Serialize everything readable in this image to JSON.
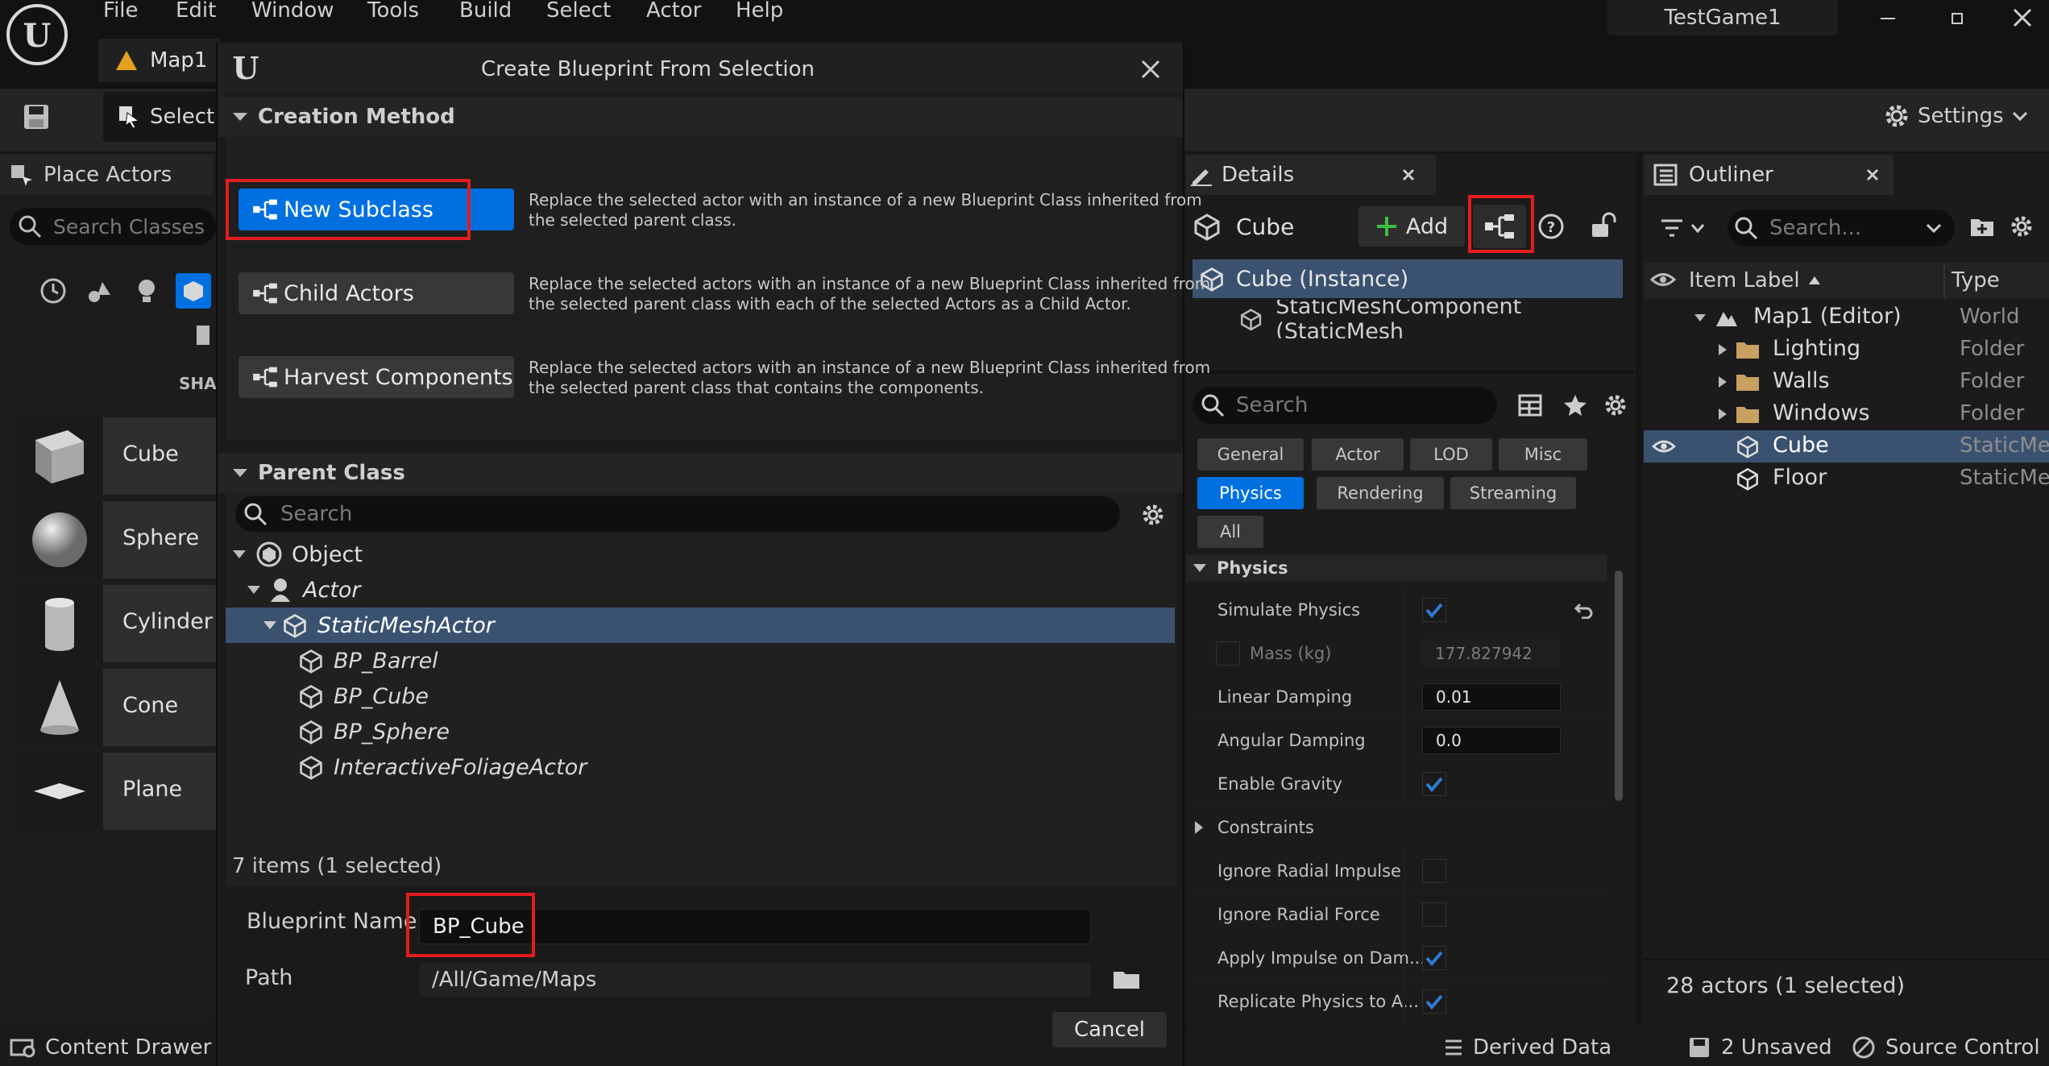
{
  "menu": [
    "File",
    "Edit",
    "Window",
    "Tools",
    "Build",
    "Select",
    "Actor",
    "Help"
  ],
  "project_name": "TestGame1",
  "map_tab": "Map1",
  "toolbar": {
    "select_label": "Select",
    "settings_label": "Settings"
  },
  "place_actors": {
    "title": "Place Actors",
    "search_placeholder": "Search Classes",
    "section_label": "SHA",
    "items": [
      "Cube",
      "Sphere",
      "Cylinder",
      "Cone",
      "Plane"
    ]
  },
  "content_drawer": "Content Drawer",
  "dialog": {
    "title": "Create Blueprint From Selection",
    "creation_method_header": "Creation Method",
    "methods": [
      {
        "label": "New Subclass",
        "desc1": "Replace the selected actor with an instance of a new Blueprint Class inherited from",
        "desc2": "the selected parent class."
      },
      {
        "label": "Child Actors",
        "desc1": "Replace the selected actors with an instance of a new Blueprint Class inherited from",
        "desc2": "the selected parent class with each of the selected Actors as a Child Actor."
      },
      {
        "label": "Harvest Components",
        "desc1": "Replace the selected actors with an instance of a new Blueprint Class inherited from",
        "desc2": "the selected parent class that contains the components."
      }
    ],
    "parent_class_header": "Parent Class",
    "search_placeholder": "Search",
    "tree": [
      "Object",
      "Actor",
      "StaticMeshActor",
      "BP_Barrel",
      "BP_Cube",
      "BP_Sphere",
      "InteractiveFoliageActor"
    ],
    "items_count": "7 items (1 selected)",
    "blueprint_name_label": "Blueprint Name",
    "blueprint_name_value": "BP_Cube",
    "path_label": "Path",
    "path_value": "/All/Game/Maps",
    "cancel_label": "Cancel"
  },
  "details": {
    "title": "Details",
    "actor_name": "Cube",
    "add_label": "Add",
    "components": [
      "Cube (Instance)",
      "StaticMeshComponent (StaticMesh"
    ],
    "search_placeholder": "Search",
    "filters": [
      "General",
      "Actor",
      "LOD",
      "Misc",
      "Physics",
      "Rendering",
      "Streaming",
      "All"
    ],
    "section": "Physics",
    "properties": [
      {
        "label": "Simulate Physics",
        "type": "check",
        "checked": true
      },
      {
        "label": "Mass (kg)",
        "type": "mass",
        "value": "177.827942"
      },
      {
        "label": "Linear Damping",
        "type": "num",
        "value": "0.01"
      },
      {
        "label": "Angular Damping",
        "type": "num",
        "value": "0.0"
      },
      {
        "label": "Enable Gravity",
        "type": "check",
        "checked": true
      },
      {
        "label": "Constraints",
        "type": "group"
      },
      {
        "label": "Ignore Radial Impulse",
        "type": "check",
        "checked": false
      },
      {
        "label": "Ignore Radial Force",
        "type": "check",
        "checked": false
      },
      {
        "label": "Apply Impulse on Dam...",
        "type": "check",
        "checked": true
      },
      {
        "label": "Replicate Physics to A...",
        "type": "check",
        "checked": true
      }
    ]
  },
  "outliner": {
    "title": "Outliner",
    "search_placeholder": "Search...",
    "col_label": "Item Label",
    "col_type": "Type",
    "rows": [
      {
        "label": "Map1 (Editor)",
        "type": "World"
      },
      {
        "label": "Lighting",
        "type": "Folder"
      },
      {
        "label": "Walls",
        "type": "Folder"
      },
      {
        "label": "Windows",
        "type": "Folder"
      },
      {
        "label": "Cube",
        "type": "StaticMesh"
      },
      {
        "label": "Floor",
        "type": "StaticMesh"
      }
    ],
    "footer": "28 actors (1 selected)"
  },
  "status": {
    "derived_data": "Derived Data",
    "unsaved": "2 Unsaved",
    "source_control": "Source Control"
  },
  "colors": {
    "accent": "#0070e0",
    "selection": "#3a5270",
    "highlight_box": "#e21d1d",
    "checkbox": "#2f7bd4"
  }
}
